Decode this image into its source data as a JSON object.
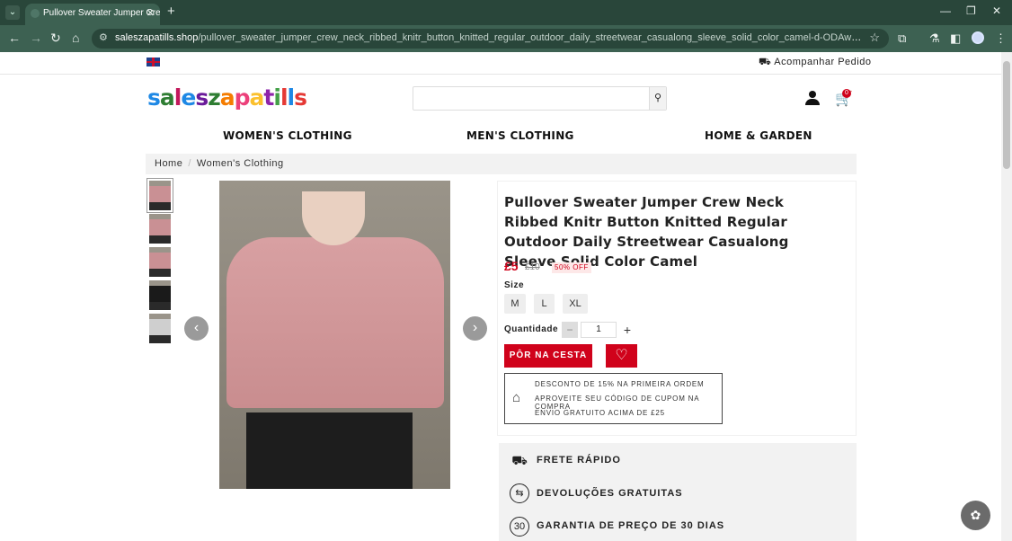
{
  "browser": {
    "tab_title": "Pullover Sweater Jumper Crew",
    "url_domain": "saleszapatills.shop",
    "url_path": "/pullover_sweater_jumper_crew_neck_ribbed_knitr_button_knitted_regular_outdoor_daily_streetwear_casualong_sleeve_solid_color_camel-d-ODAwMjAwMDUx-ODAwMjAwMDUxMDA=-..."
  },
  "topbar": {
    "track_label": "Acompanhar Pedido",
    "cart_count": "0"
  },
  "logo": {
    "letters": [
      "s",
      "a",
      "l",
      "e",
      "s",
      "z",
      "a",
      "p",
      "a",
      "t",
      "i",
      "l",
      "l",
      "s"
    ],
    "colors": [
      "#1e88e5",
      "#2e7d32",
      "#c2185b",
      "#1e88e5",
      "#6a1b9a",
      "#2e7d32",
      "#f57c00",
      "#ec407a",
      "#fbc02d",
      "#8e24aa",
      "#43a047",
      "#e53935",
      "#1e88e5",
      "#e53935"
    ]
  },
  "nav": {
    "womens": "WOMEN'S CLOTHING",
    "mens": "MEN'S CLOTHING",
    "home": "HOME & GARDEN"
  },
  "breadcrumb": {
    "home": "Home",
    "sep": "/",
    "current": "Women's Clothing"
  },
  "product": {
    "title": "Pullover Sweater Jumper Crew Neck Ribbed Knitr Button Knitted Regular Outdoor Daily Streetwear Casualong Sleeve Solid Color Camel",
    "price": "£5",
    "old_price": "£10",
    "discount": "50% OFF",
    "size_label": "Size",
    "sizes": [
      "M",
      "L",
      "XL"
    ],
    "qty_label": "Quantidade",
    "qty_value": "1",
    "add_to_cart": "PÔR NA CESTA",
    "thumb_colors": [
      "#c99094",
      "#c99094",
      "#c99094",
      "#1a1a1a",
      "#cfcfcf"
    ]
  },
  "promo": {
    "line1": "DESCONTO DE 15% NA PRIMEIRA ORDEM",
    "line2": "APROVEITE SEU CÓDIGO DE CUPOM NA COMPRA",
    "line3": "ENVIO GRATUITO ACIMA DE £25"
  },
  "features": {
    "shipping": "FRETE RÁPIDO",
    "returns": "DEVOLUÇÕES GRATUITAS",
    "guarantee": "GARANTIA DE PREÇO DE 30 DIAS",
    "guarantee_icon_text": "30"
  }
}
